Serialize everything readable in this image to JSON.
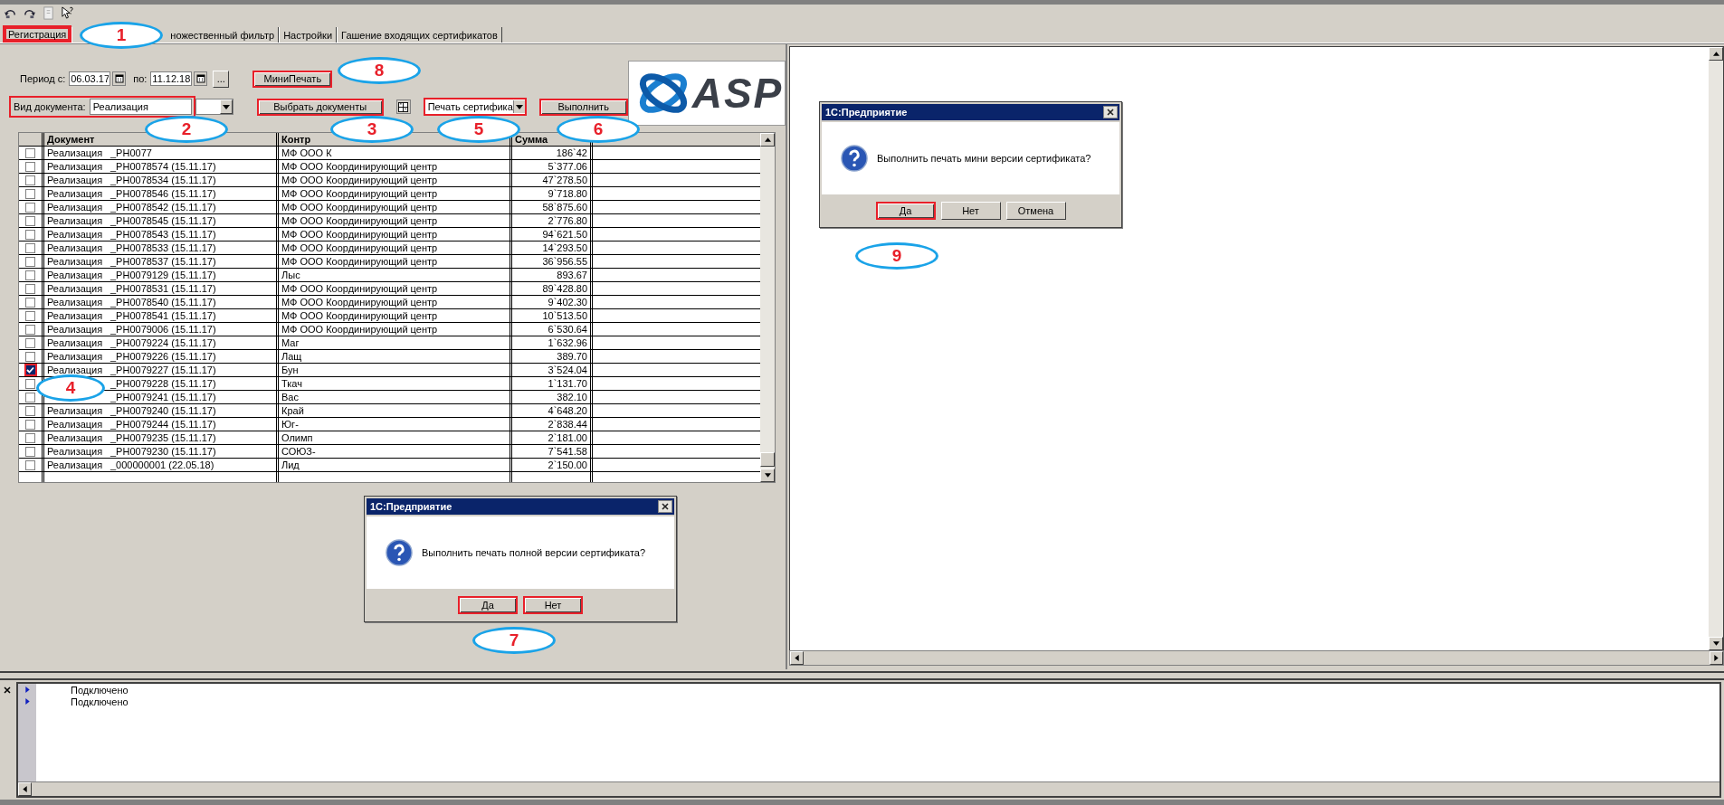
{
  "tabs": [
    {
      "label": "Регистрация",
      "selected": true,
      "highlighted": true
    },
    {
      "label": "ножественный фильтр",
      "selected": false,
      "highlighted": false
    },
    {
      "label": "Настройки",
      "selected": false,
      "highlighted": false
    },
    {
      "label": "Гашение входящих сертификатов",
      "selected": false,
      "highlighted": false
    }
  ],
  "filter": {
    "period_label": "Период с:",
    "date_from": "06.03.17",
    "to_label": "по:",
    "date_to": "11.12.18",
    "more_button": "...",
    "mini_print_button": {
      "label": "МиниПечать",
      "highlighted": true
    },
    "doc_type": {
      "label": "Вид документа:",
      "value": "Реализация",
      "highlighted": true
    },
    "select_button": {
      "label": "Выбрать документы",
      "highlighted": true
    },
    "print_mode": {
      "value": "Печать сертифика",
      "highlighted": true
    },
    "execute_button": {
      "label": "Выполнить",
      "highlighted": true
    }
  },
  "logo": {
    "text": "ASP"
  },
  "table": {
    "columns": [
      "Документ",
      "Контр",
      "Сумма"
    ],
    "rows": [
      {
        "doc_type": "Реализация",
        "number": "_РН0077",
        "contractor": "МФ ООО К",
        "amount": "186`42",
        "checked": false,
        "highlighted": false
      },
      {
        "doc_type": "Реализация",
        "number": "_РН0078574 (15.11.17)",
        "contractor": "МФ ООО Координирующий центр",
        "amount": "5`377.06",
        "checked": false,
        "highlighted": false
      },
      {
        "doc_type": "Реализация",
        "number": "_РН0078534 (15.11.17)",
        "contractor": "МФ ООО Координирующий центр",
        "amount": "47`278.50",
        "checked": false,
        "highlighted": false
      },
      {
        "doc_type": "Реализация",
        "number": "_РН0078546 (15.11.17)",
        "contractor": "МФ ООО Координирующий центр",
        "amount": "9`718.80",
        "checked": false,
        "highlighted": false
      },
      {
        "doc_type": "Реализация",
        "number": "_РН0078542 (15.11.17)",
        "contractor": "МФ ООО Координирующий центр",
        "amount": "58`875.60",
        "checked": false,
        "highlighted": false
      },
      {
        "doc_type": "Реализация",
        "number": "_РН0078545 (15.11.17)",
        "contractor": "МФ ООО Координирующий центр",
        "amount": "2`776.80",
        "checked": false,
        "highlighted": false
      },
      {
        "doc_type": "Реализация",
        "number": "_РН0078543 (15.11.17)",
        "contractor": "МФ ООО Координирующий центр",
        "amount": "94`621.50",
        "checked": false,
        "highlighted": false
      },
      {
        "doc_type": "Реализация",
        "number": "_РН0078533 (15.11.17)",
        "contractor": "МФ ООО Координирующий центр",
        "amount": "14`293.50",
        "checked": false,
        "highlighted": false
      },
      {
        "doc_type": "Реализация",
        "number": "_РН0078537 (15.11.17)",
        "contractor": "МФ ООО Координирующий центр",
        "amount": "36`956.55",
        "checked": false,
        "highlighted": false
      },
      {
        "doc_type": "Реализация",
        "number": "_РН0079129 (15.11.17)",
        "contractor": "Лыс",
        "amount": "893.67",
        "checked": false,
        "highlighted": false
      },
      {
        "doc_type": "Реализация",
        "number": "_РН0078531 (15.11.17)",
        "contractor": "МФ ООО Координирующий центр",
        "amount": "89`428.80",
        "checked": false,
        "highlighted": false
      },
      {
        "doc_type": "Реализация",
        "number": "_РН0078540 (15.11.17)",
        "contractor": "МФ ООО Координирующий центр",
        "amount": "9`402.30",
        "checked": false,
        "highlighted": false
      },
      {
        "doc_type": "Реализация",
        "number": "_РН0078541 (15.11.17)",
        "contractor": "МФ ООО Координирующий центр",
        "amount": "10`513.50",
        "checked": false,
        "highlighted": false
      },
      {
        "doc_type": "Реализация",
        "number": "_РН0079006 (15.11.17)",
        "contractor": "МФ ООО Координирующий центр",
        "amount": "6`530.64",
        "checked": false,
        "highlighted": false
      },
      {
        "doc_type": "Реализация",
        "number": "_РН0079224 (15.11.17)",
        "contractor": "Маг",
        "amount": "1`632.96",
        "checked": false,
        "highlighted": false
      },
      {
        "doc_type": "Реализация",
        "number": "_РН0079226 (15.11.17)",
        "contractor": "Лащ",
        "amount": "389.70",
        "checked": false,
        "highlighted": false
      },
      {
        "doc_type": "Реализация",
        "number": "_РН0079227 (15.11.17)",
        "contractor": "Бун",
        "amount": "3`524.04",
        "checked": true,
        "highlighted": true
      },
      {
        "number": "_РН0079228 (15.11.17)",
        "contractor": "Ткач",
        "amount": "1`131.70",
        "checked": false,
        "highlighted": false
      },
      {
        "number": "_РН0079241 (15.11.17)",
        "contractor": "Вас",
        "amount": "382.10",
        "checked": false,
        "highlighted": false
      },
      {
        "doc_type": "Реализация",
        "number": "_РН0079240 (15.11.17)",
        "contractor": "Край",
        "amount": "4`648.20",
        "checked": false,
        "highlighted": false
      },
      {
        "doc_type": "Реализация",
        "number": "_РН0079244 (15.11.17)",
        "contractor": "Юг-",
        "amount": "2`838.44",
        "checked": false,
        "highlighted": false
      },
      {
        "doc_type": "Реализация",
        "number": "_РН0079235 (15.11.17)",
        "contractor": "Олимп",
        "amount": "2`181.00",
        "checked": false,
        "highlighted": false
      },
      {
        "doc_type": "Реализация",
        "number": "_РН0079230 (15.11.17)",
        "contractor": "СОЮЗ-",
        "amount": "7`541.58",
        "checked": false,
        "highlighted": false
      },
      {
        "doc_type": "Реализация",
        "number": "_000000001 (22.05.18)",
        "contractor": "Лид",
        "amount": "2`150.00",
        "checked": false,
        "highlighted": false
      }
    ]
  },
  "dialogs": [
    {
      "title": "1С:Предприятие",
      "message": "Выполнить печать полной версии сертификата?",
      "buttons": [
        {
          "label": "Да",
          "highlighted": true
        },
        {
          "label": "Нет",
          "highlighted": true
        }
      ]
    },
    {
      "title": "1С:Предприятие",
      "message": "Выполнить печать мини версии сертификата?",
      "buttons": [
        {
          "label": "Да",
          "highlighted": true
        },
        {
          "label": "Нет",
          "highlighted": false
        },
        {
          "label": "Отмена",
          "highlighted": false
        }
      ]
    }
  ],
  "log": {
    "lines": [
      "Подключено",
      "Подключено"
    ]
  },
  "callouts": [
    "1",
    "2",
    "3",
    "4",
    "5",
    "6",
    "7",
    "8",
    "9"
  ]
}
